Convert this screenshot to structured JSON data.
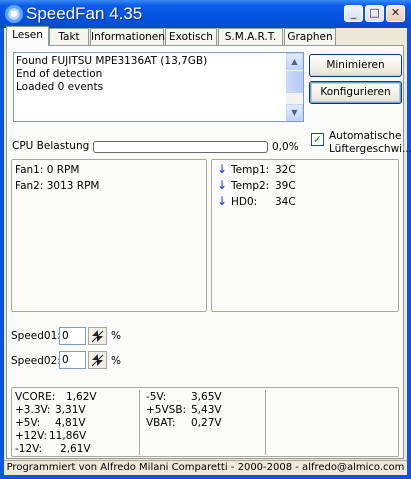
{
  "window": {
    "title": "SpeedFan 4.35",
    "minimize_glyph": "_",
    "maximize_glyph": "□",
    "close_glyph": "✕"
  },
  "tabs": [
    {
      "label": "Lesen",
      "active": true
    },
    {
      "label": "Takt"
    },
    {
      "label": "Informationen"
    },
    {
      "label": "Exotisch"
    },
    {
      "label": "S.M.A.R.T."
    },
    {
      "label": "Graphen"
    }
  ],
  "log": [
    "Found FUJITSU MPE3136AT (13,7GB)",
    "End of detection",
    "Loaded 0 events"
  ],
  "buttons": {
    "minimize": "Minimieren",
    "configure": "Konfigurieren"
  },
  "auto_fan": {
    "checked": true,
    "label": "Automatische Lüftergeschwi..."
  },
  "cpu": {
    "label": "CPU Belastung",
    "value": "0,0%",
    "progress": 0.0
  },
  "fans": [
    {
      "label": "Fan1: 0 RPM"
    },
    {
      "label": "Fan2: 3013 RPM"
    }
  ],
  "temps": [
    {
      "name": "Temp1:",
      "value": "32C",
      "trend": "down"
    },
    {
      "name": "Temp2:",
      "value": "39C",
      "trend": "down"
    },
    {
      "name": "HD0:",
      "value": "34C",
      "trend": "down"
    }
  ],
  "speeds": [
    {
      "label": "Speed01:",
      "value": "0",
      "unit": "%"
    },
    {
      "label": "Speed02:",
      "value": "0",
      "unit": "%"
    }
  ],
  "voltages": [
    {
      "name": "VCORE:",
      "value": "1,62V"
    },
    {
      "name": "+3.3V:",
      "value": "3,31V"
    },
    {
      "name": "+5V:",
      "value": "4,81V"
    },
    {
      "name": "+12V:",
      "value": "11,86V"
    },
    {
      "name": "-12V:",
      "value": "2,61V"
    },
    {
      "name": "-5V:",
      "value": "3,65V"
    },
    {
      "name": "+5VSB:",
      "value": "5,43V"
    },
    {
      "name": "VBAT:",
      "value": "0,27V"
    }
  ],
  "footer": "Programmiert von Alfredo Milani Comparetti - 2000-2008 - alfredo@almico.com",
  "colors": {
    "titlebar": "#0554e1",
    "progress": "#2bd228",
    "trend_arrow": "#1a2fd1"
  }
}
